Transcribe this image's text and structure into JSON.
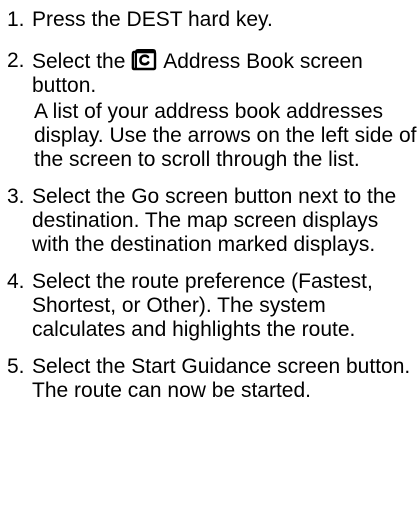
{
  "steps": [
    {
      "number": "1.",
      "text": "Press the DEST hard key."
    },
    {
      "number": "2.",
      "text_before_icon": "Select the",
      "icon": "address-book-icon",
      "text_after_icon": "Address Book screen button.",
      "note": "A list of your address book addresses display. Use the arrows on the left side of the screen to scroll through the list."
    },
    {
      "number": "3.",
      "text": "Select the Go screen button next to the destination. The map screen displays with the destination marked displays."
    },
    {
      "number": "4.",
      "text": "Select the route preference (Fastest, Shortest, or Other). The system calculates and highlights the route."
    },
    {
      "number": "5.",
      "text": "Select the Start Guidance screen button. The route can now be started."
    }
  ]
}
